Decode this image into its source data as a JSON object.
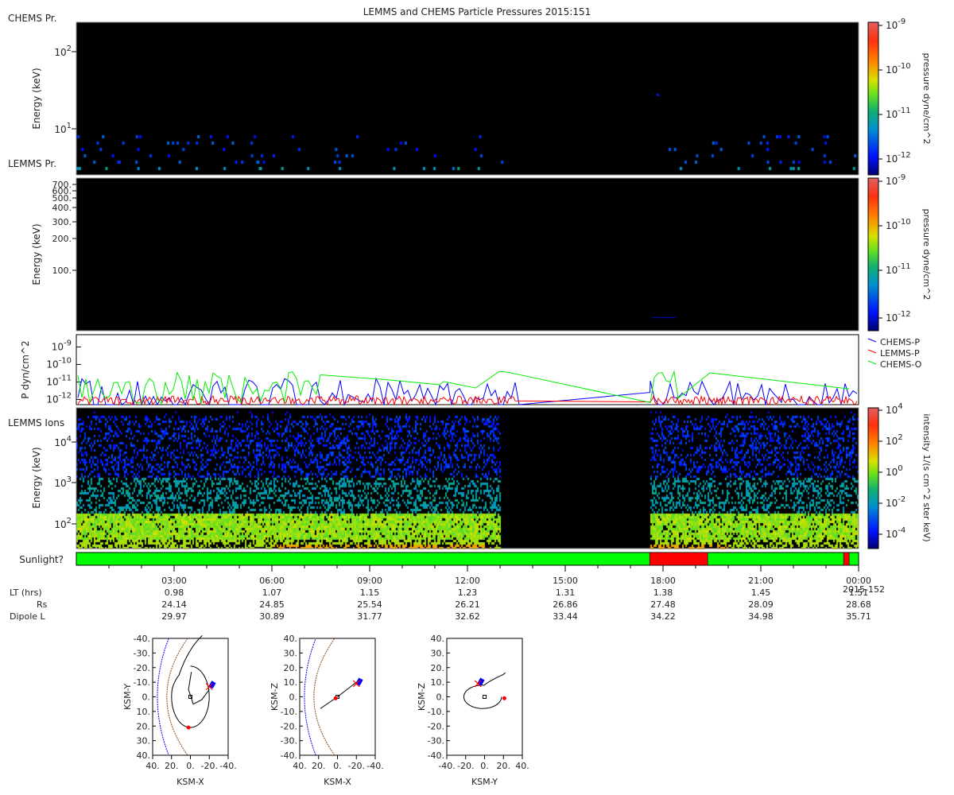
{
  "title": "LEMMS and CHEMS Particle Pressures  2015:151",
  "panels": {
    "chems": {
      "label": "CHEMS Pr.",
      "ylabel": "Energy (keV)",
      "yticks": [
        {
          "v": 10,
          "t": "10",
          "e": "1"
        },
        {
          "v": 100,
          "t": "10",
          "e": "2"
        }
      ],
      "ylim": [
        2.5,
        240
      ],
      "cbar_label": "pressure dyne/cm^2",
      "cbar_ticks": [
        {
          "t": "10",
          "e": "-9"
        },
        {
          "t": "10",
          "e": "-10"
        },
        {
          "t": "10",
          "e": "-11"
        },
        {
          "t": "10",
          "e": "-12"
        }
      ],
      "cbar_range": [
        -12.2,
        -8.9
      ]
    },
    "lemms": {
      "label": "LEMMS Pr.",
      "ylabel": "Energy (keV)",
      "yticks": [
        "700.",
        "600.",
        "500.",
        "400.",
        "300.",
        "200.",
        "100."
      ],
      "ylim": [
        27,
        745
      ],
      "cbar_label": "pressure dyne/cm^2",
      "cbar_ticks": [
        {
          "t": "10",
          "e": "-9"
        },
        {
          "t": "10",
          "e": "-10"
        },
        {
          "t": "10",
          "e": "-11"
        },
        {
          "t": "10",
          "e": "-12"
        }
      ]
    },
    "pressure": {
      "ylabel": "P dyn/cm^2",
      "yticks": [
        {
          "t": "10",
          "e": "-9"
        },
        {
          "t": "10",
          "e": "-10"
        },
        {
          "t": "10",
          "e": "-11"
        },
        {
          "t": "10",
          "e": "-12"
        }
      ],
      "ylim_log10": [
        -12.3,
        -8.3
      ],
      "legend": [
        {
          "name": "CHEMS-P",
          "color": "#0000ff"
        },
        {
          "name": "LEMMS-P",
          "color": "#ff0000"
        },
        {
          "name": "CHEMS-O",
          "color": "#00ee00"
        }
      ],
      "legend_position": "right"
    },
    "ions": {
      "label": "LEMMS Ions",
      "ylabel": "Energy (keV)",
      "yticks": [
        {
          "t": "10",
          "e": "4"
        },
        {
          "t": "10",
          "e": "3"
        },
        {
          "t": "10",
          "e": "2"
        }
      ],
      "ylim": [
        25,
        68000
      ],
      "cbar_label": "intensity 1/(s cm^2 ster keV)",
      "cbar_ticks": [
        {
          "t": "10",
          "e": "4"
        },
        {
          "t": "10",
          "e": "2"
        },
        {
          "t": "10",
          "e": "0"
        },
        {
          "t": "10",
          "e": "-2"
        },
        {
          "t": "10",
          "e": "-4"
        }
      ],
      "data_gap_hours": [
        13.0,
        17.6
      ]
    }
  },
  "sunlight": {
    "label": "Sunlight?",
    "colors": {
      "yes": "#00ff00",
      "no": "#ff0000"
    },
    "shadow_intervals_hours": [
      [
        17.59,
        19.37
      ],
      [
        23.54,
        23.71
      ]
    ]
  },
  "time_axis": {
    "ticks": [
      "03:00",
      "06:00",
      "09:00",
      "12:00",
      "15:00",
      "18:00",
      "21:00",
      "00:00"
    ],
    "end_date": "2015-152",
    "rows": [
      {
        "label": "LT (hrs)",
        "values": [
          "0.98",
          "1.07",
          "1.15",
          "1.23",
          "1.31",
          "1.38",
          "1.45",
          "1.51"
        ]
      },
      {
        "label": "Rs",
        "values": [
          "24.14",
          "24.85",
          "25.54",
          "26.21",
          "26.86",
          "27.48",
          "28.09",
          "28.68"
        ]
      },
      {
        "label": "Dipole L",
        "values": [
          "29.97",
          "30.89",
          "31.77",
          "32.62",
          "33.44",
          "34.22",
          "34.98",
          "35.71"
        ]
      }
    ]
  },
  "orbits": [
    {
      "xlabel": "KSM-X",
      "ylabel": "KSM-Y",
      "xticks": [
        "40.",
        "20.",
        "0.",
        "-20.",
        "-40."
      ],
      "yticks": [
        "-40.",
        "-30.",
        "-20.",
        "-10.",
        "0.",
        "10.",
        "20.",
        "30.",
        "40."
      ]
    },
    {
      "xlabel": "KSM-X",
      "ylabel": "KSM-Z",
      "xticks": [
        "40.",
        "20.",
        "0.",
        "-20.",
        "-40."
      ],
      "yticks": [
        "40.",
        "30.",
        "20.",
        "10.",
        "0.",
        "-10.",
        "-20.",
        "-30.",
        "-40."
      ]
    },
    {
      "xlabel": "KSM-Y",
      "ylabel": "KSM-Z",
      "xticks": [
        "-40.",
        "-20.",
        "0.",
        "20.",
        "40."
      ],
      "yticks": [
        "40.",
        "30.",
        "20.",
        "10.",
        "0.",
        "-10.",
        "-20.",
        "-30.",
        "-40."
      ]
    }
  ],
  "chart_data": {
    "type": "heatmap",
    "title": "LEMMS and CHEMS Particle Pressures  2015:151",
    "x_range_hours": [
      0,
      24
    ],
    "colormap": "rainbow (navy-blue-cyan-green-yellow-orange-red)"
  }
}
